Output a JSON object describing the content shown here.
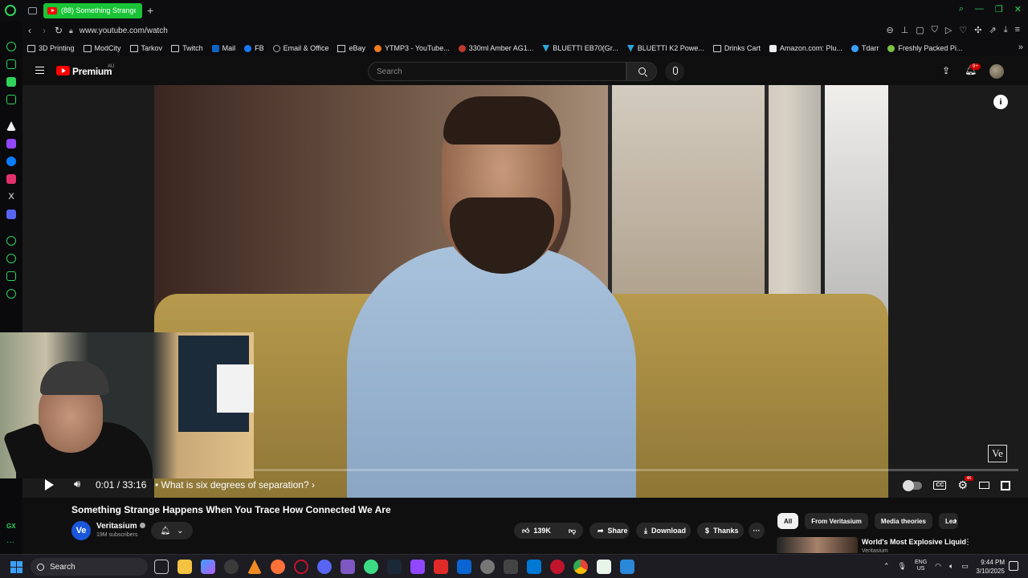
{
  "browser": {
    "tab_title": "(88) Something Strange H",
    "url": "www.youtube.com/watch",
    "bookmarks": [
      "3D Printing",
      "ModCity",
      "Tarkov",
      "Twitch",
      "Mail",
      "FB",
      "Email & Office",
      "eBay",
      "YTMP3 - YouTube...",
      "330ml Amber AG1...",
      "BLUETTI EB70(Gr...",
      "BLUETTI K2 Powe...",
      "Drinks Cart",
      "Amazon.com: Plu...",
      "Tdarr",
      "Freshly Packed Pi..."
    ]
  },
  "youtube": {
    "brand": "Premium",
    "region": "AU",
    "search_placeholder": "Search",
    "notification_badge": "9+"
  },
  "player": {
    "time": "0:01 / 33:16",
    "chapter": "• What is six degrees of separation? ›",
    "progress_fraction": 0.0005,
    "watermark": "Ve",
    "info_icon": "i",
    "quality_badge": "4K",
    "cc_label": "CC"
  },
  "video": {
    "title": "Something Strange Happens When You Trace How Connected We Are",
    "channel_initials": "Ve",
    "channel_name": "Veritasium",
    "subscribers": "19M subscribers",
    "likes": "139K",
    "share_label": "Share",
    "download_label": "Download",
    "thanks_label": "Thanks"
  },
  "related": {
    "chips": [
      "All",
      "From Veritasium",
      "Media theories",
      "Lea"
    ],
    "first_title": "World's Most Explosive Liquid",
    "first_channel": "Veritasium"
  },
  "taskbar": {
    "search_placeholder": "Search",
    "lang": "ENG",
    "region": "US",
    "time": "9:44 PM",
    "date": "3/10/2025"
  },
  "colors": {
    "opera_green": "#19c437",
    "youtube_red": "#ff0000",
    "background": "#0f0f0f"
  }
}
